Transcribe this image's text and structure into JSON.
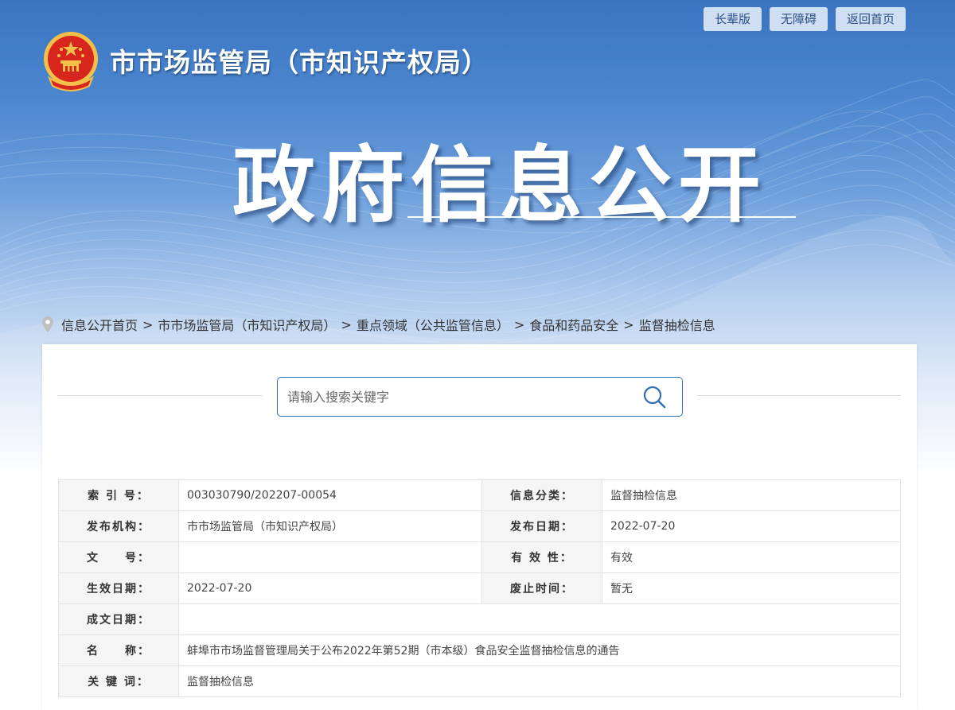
{
  "top_links": [
    "长辈版",
    "无障碍",
    "返回首页"
  ],
  "header": {
    "org_name": "市市场监管局（市知识产权局）",
    "title": "政府信息公开"
  },
  "breadcrumb": [
    "信息公开首页",
    "市市场监管局（市知识产权局）",
    "重点领域（公共监管信息）",
    "食品和药品安全",
    "监督抽检信息"
  ],
  "breadcrumb_sep": ">",
  "search": {
    "placeholder": "请输入搜索关键字"
  },
  "meta": {
    "index_no_label": "索 引 号：",
    "index_no": "003030790/202207-00054",
    "category_label": "信息分类：",
    "category": "监督抽检信息",
    "publisher_label": "发布机构：",
    "publisher": "市市场监管局（市知识产权局）",
    "pub_date_label": "发布日期：",
    "pub_date": "2022-07-20",
    "doc_no_label": "文　　号：",
    "doc_no": "",
    "validity_label": "有 效 性：",
    "validity": "有效",
    "effective_date_label": "生效日期：",
    "effective_date": "2022-07-20",
    "expire_label": "废止时间：",
    "expire": "暂无",
    "created_label": "成文日期：",
    "created": "",
    "name_label": "名　　称：",
    "name": "蚌埠市市场监督管理局关于公布2022年第52期（市本级）食品安全监督抽检信息的通告",
    "keywords_label": "关 键 词：",
    "keywords": "监督抽检信息"
  }
}
